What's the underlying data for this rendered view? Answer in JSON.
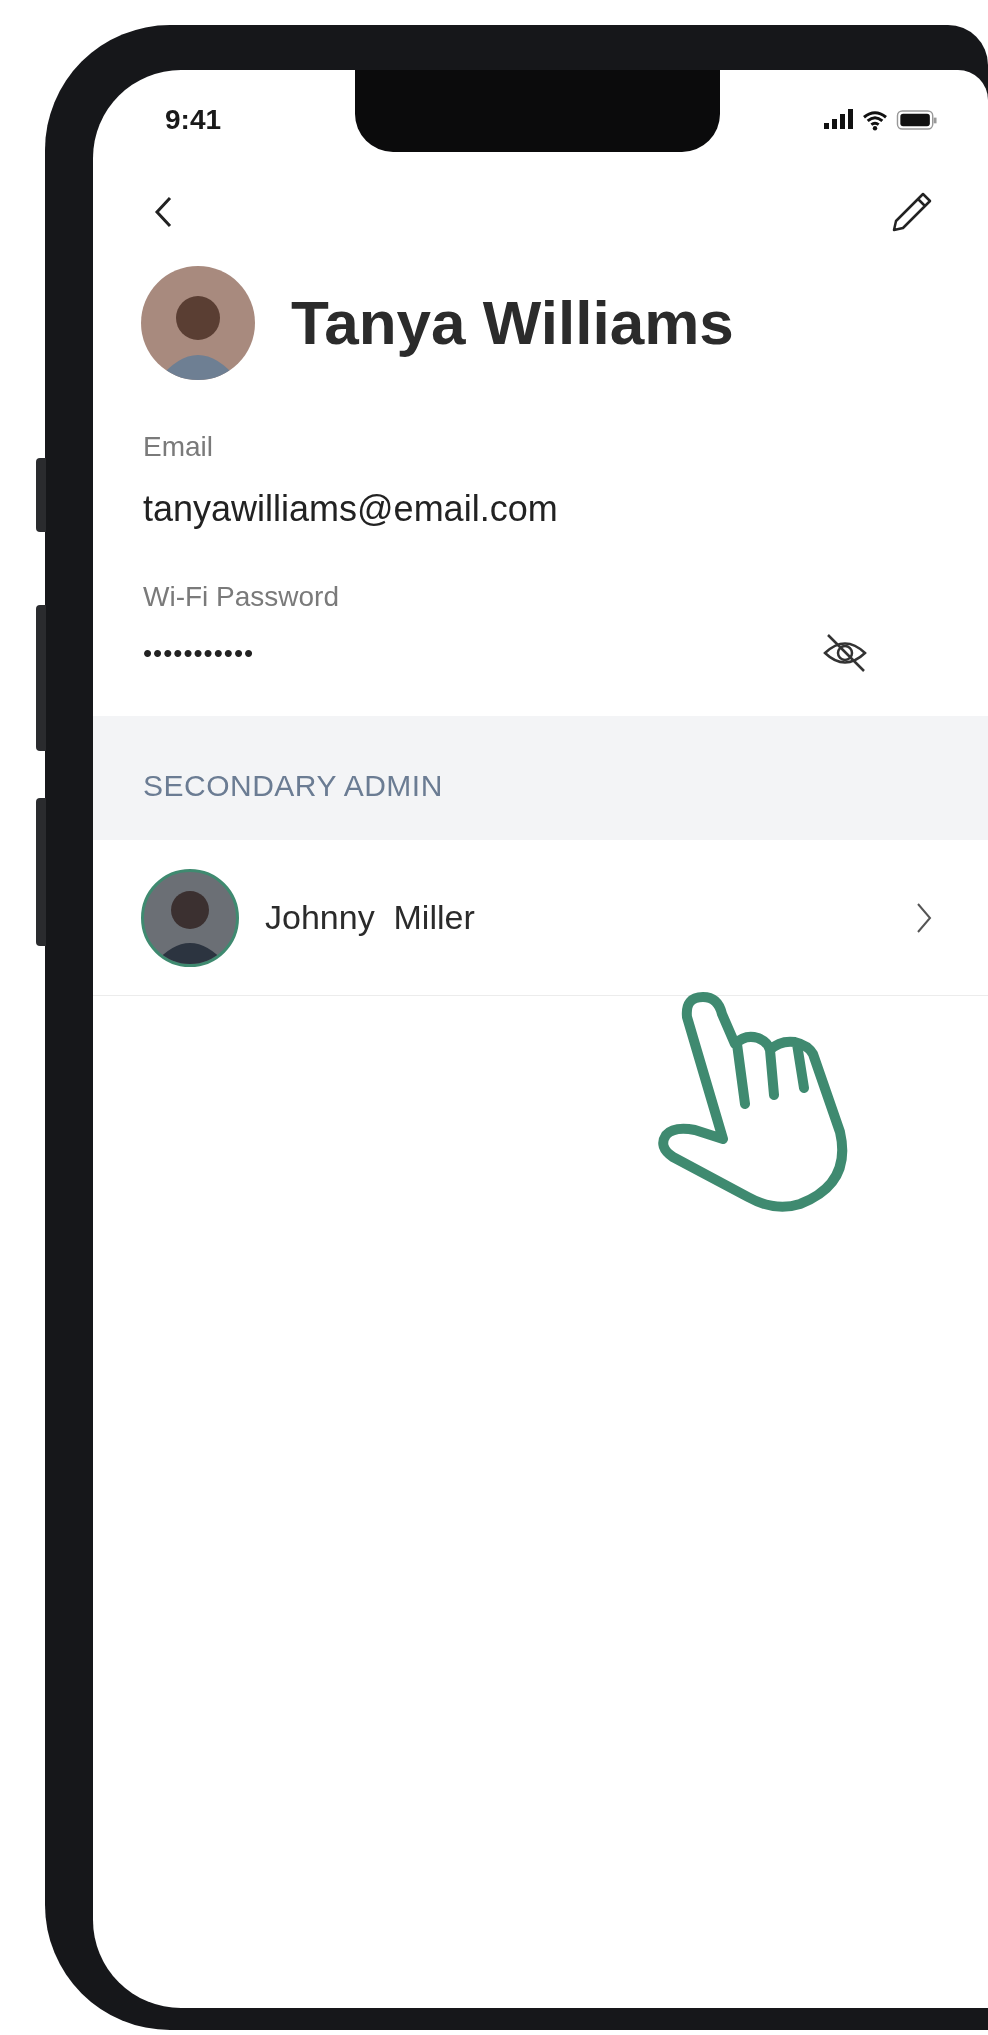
{
  "status_bar": {
    "time": "9:41"
  },
  "profile": {
    "name": "Tanya Williams"
  },
  "fields": [
    {
      "kind": "text",
      "label": "Email",
      "value": "tanyawilliams@email.com"
    },
    {
      "kind": "secret",
      "label": "Wi-Fi Password",
      "value": "•••••••••••"
    }
  ],
  "section": {
    "title": "SECONDARY ADMIN"
  },
  "admins": [
    {
      "name": "Johnny  Miller"
    }
  ]
}
